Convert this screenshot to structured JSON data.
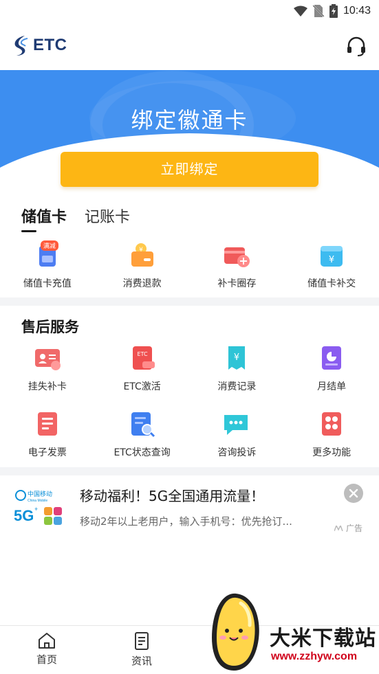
{
  "status_bar": {
    "time": "10:43"
  },
  "header": {
    "logo_text": "ETC"
  },
  "banner": {
    "title": "绑定徽通卡",
    "button_label": "立即绑定",
    "bg_color": "#3d8ef0",
    "button_color": "#fdb614"
  },
  "card_tabs": [
    {
      "label": "储值卡",
      "active": true
    },
    {
      "label": "记账卡",
      "active": false
    }
  ],
  "card_features": [
    {
      "label": "储值卡充值",
      "icon": "card-recharge-icon",
      "badge": "满减"
    },
    {
      "label": "消费退款",
      "icon": "refund-wallet-icon"
    },
    {
      "label": "补卡圈存",
      "icon": "card-topup-icon"
    },
    {
      "label": "储值卡补交",
      "icon": "yuan-bag-icon"
    }
  ],
  "after_sales": {
    "title": "售后服务",
    "items": [
      {
        "label": "挂失补卡",
        "icon": "report-loss-icon"
      },
      {
        "label": "ETC激活",
        "icon": "etc-activate-icon"
      },
      {
        "label": "消费记录",
        "icon": "consumption-record-icon"
      },
      {
        "label": "月结单",
        "icon": "monthly-statement-icon"
      },
      {
        "label": "电子发票",
        "icon": "e-invoice-icon"
      },
      {
        "label": "ETC状态查询",
        "icon": "etc-status-query-icon"
      },
      {
        "label": "咨询投诉",
        "icon": "consult-complaint-icon"
      },
      {
        "label": "更多功能",
        "icon": "more-functions-icon"
      }
    ]
  },
  "ad": {
    "title": "移动福利！5G全国通用流量！",
    "description": "移动2年以上老用户，输入手机号：优先抢订...",
    "tag": "广告",
    "brand_cn": "中国移动",
    "brand_en": "China Mobile"
  },
  "bottom_nav": [
    {
      "label": "首页",
      "icon": "home-icon"
    },
    {
      "label": "资讯",
      "icon": "news-icon"
    }
  ],
  "watermark": {
    "text": "大米下载站",
    "url": "www.zzhyw.com"
  }
}
